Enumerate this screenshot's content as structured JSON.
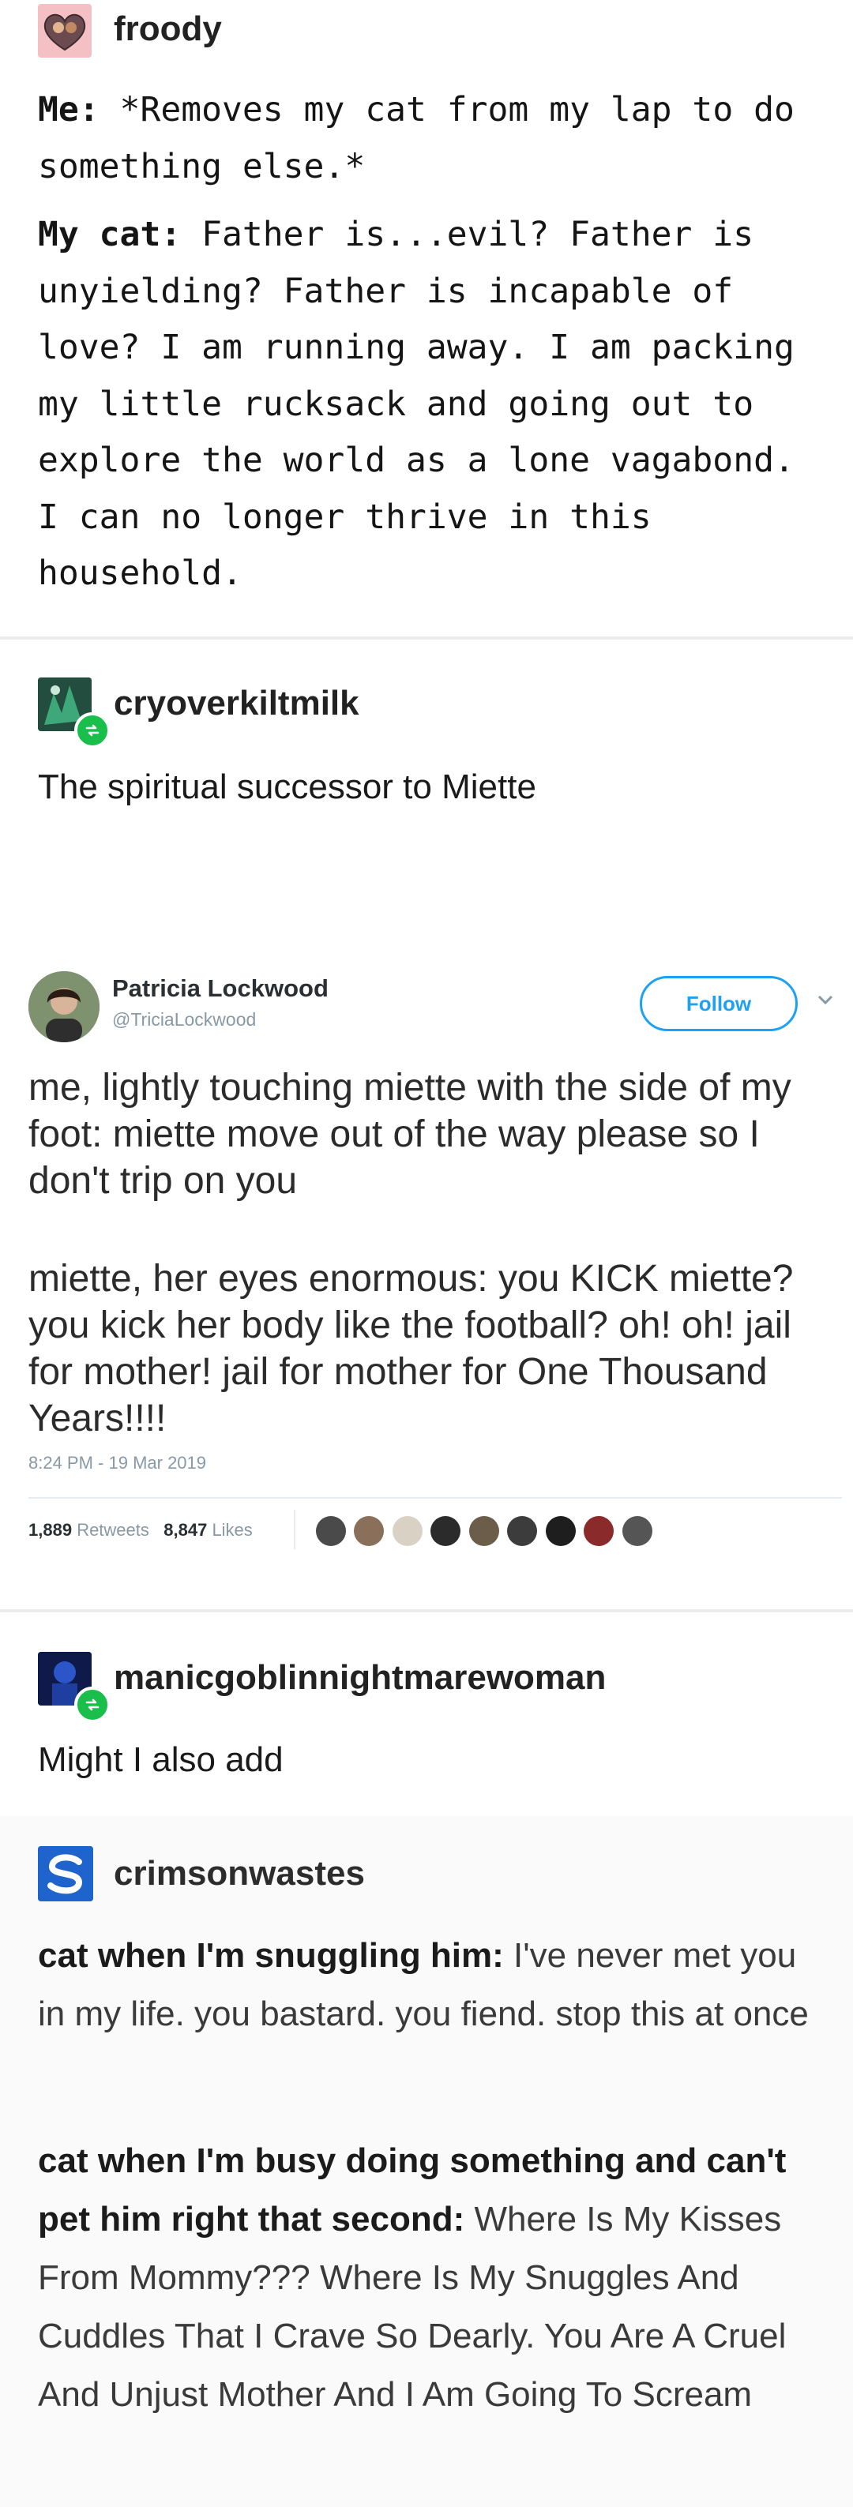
{
  "post1": {
    "username": "froody",
    "line1_label": "Me:",
    "line1_text": " *Removes my cat from my lap to do something else.*",
    "line2_label": "My cat:",
    "line2_text": " Father is...evil? Father is unyielding? Father is incapable of love? I am running away. I am packing my little rucksack and going out to explore the world as a lone vagabond. I can no longer thrive in this household."
  },
  "post2": {
    "username": "cryoverkiltmilk",
    "text": "The spiritual successor to Miette"
  },
  "tweet": {
    "name": "Patricia Lockwood",
    "handle": "@TriciaLockwood",
    "follow_label": "Follow",
    "paragraph1": "me, lightly touching miette with the side of my foot: miette move out of the way please so I don't trip on you",
    "paragraph2": "miette, her eyes enormous: you KICK miette? you kick her body like the football? oh! oh! jail for mother! jail for mother for One Thousand Years!!!!",
    "timestamp": "8:24 PM - 19 Mar 2019",
    "retweets_count": "1,889",
    "retweets_label": "Retweets",
    "likes_count": "8,847",
    "likes_label": "Likes"
  },
  "post3": {
    "username": "manicgoblinnightmarewoman",
    "text": "Might I also add"
  },
  "post4": {
    "username": "crimsonwastes",
    "p1_label": "cat when I'm snuggling him:",
    "p1_text": " I've never met you in my life. you bastard. you fiend. stop this at once",
    "p2_label": "cat when I'm busy doing something and can't pet him right that second:",
    "p2_text": " Where Is My Kisses From Mommy??? Where Is My Snuggles And Cuddles That I Crave So Dearly. You Are A Cruel And Unjust Mother And I Am Going To Scream"
  },
  "icons": [
    "heart-avatar-icon",
    "reblog-icon",
    "chevron-down-icon",
    "liker-avatar-icon"
  ],
  "colors": {
    "twitter_blue": "#1da1f2",
    "reblog_green": "#19bf4a",
    "divider": "#ececec"
  }
}
